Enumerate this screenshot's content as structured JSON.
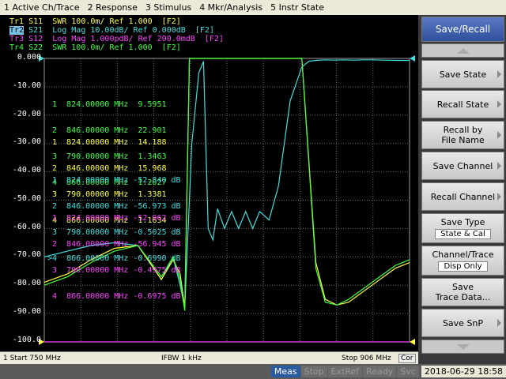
{
  "menu": [
    "1 Active Ch/Trace",
    "2 Response",
    "3 Stimulus",
    "4 Mkr/Analysis",
    "5 Instr State"
  ],
  "traces": [
    {
      "id": "Tr1",
      "text": "S11  SWR 100.0m/ Ref 1.000  [F2]",
      "color": "#ffff40"
    },
    {
      "id": "Tr2",
      "text": "S21  Log Mag 10.00dB/ Ref 0.000dB  [F2]",
      "color": "#40e0e0"
    },
    {
      "id": "Tr3",
      "text": "S12  Log Mag 1.000pdB/ Ref 200.0mdB  [F2]",
      "color": "#ff40ff"
    },
    {
      "id": "Tr4",
      "text": "S22  SWR 100.0m/ Ref 1.000  [F2]",
      "color": "#40ff40"
    }
  ],
  "y_labels": [
    "0.000",
    "-10.00",
    "-20.00",
    "-30.00",
    "-40.00",
    "-50.00",
    "-60.00",
    "-70.00",
    "-80.00",
    "-90.00",
    "-100.0"
  ],
  "marker_tables": [
    {
      "color": "#40ff40",
      "rows": [
        "1  824.00000 MHz  9.5951",
        "2  846.00000 MHz  22.901",
        "3  790.00000 MHz  1.3463",
        "4  866.00000 MHz  1.2027"
      ]
    },
    {
      "color": "#ffff40",
      "rows": [
        "1  824.00000 MHz  14.188",
        "2  846.00000 MHz  15.968",
        "3  790.00000 MHz  1.3381",
        "4  866.00000 MHz  1.1634"
      ]
    },
    {
      "color": "#40e0e0",
      "rows": [
        "1  824.00000 MHz -52.840 dB",
        "2  846.00000 MHz -56.973 dB",
        "3  790.00000 MHz -0.5025 dB",
        ">4  866.00000 MHz -0.6990 dB"
      ]
    },
    {
      "color": "#ff40ff",
      "rows": [
        "1  824.00000 MHz -52.962 dB",
        "2  846.00000 MHz -56.945 dB",
        "3  790.00000 MHz -0.4975 dB",
        "4  866.00000 MHz -0.6975 dB"
      ]
    }
  ],
  "status": {
    "start": "1  Start 750 MHz",
    "ifbw": "IFBW 1 kHz",
    "stop": "Stop 906 MHz",
    "cor": "Cor"
  },
  "bottom": {
    "meas": "Meas",
    "stop": "Stop",
    "extref": "ExtRef",
    "ready": "Ready",
    "svc": "Svc",
    "datetime": "2018-06-29 18:58"
  },
  "side": {
    "title": "Save/Recall",
    "save_state": "Save State",
    "recall_state": "Recall State",
    "recall_by_file_1": "Recall by",
    "recall_by_file_2": "File Name",
    "save_channel": "Save Channel",
    "recall_channel": "Recall Channel",
    "save_type": "Save Type",
    "save_type_value": "State & Cal",
    "channel_trace": "Channel/Trace",
    "channel_trace_value": "Disp Only",
    "save_trace_1": "Save",
    "save_trace_2": "Trace Data...",
    "save_snp": "Save SnP"
  },
  "chart_data": {
    "type": "line",
    "x_unit": "MHz",
    "xlim": [
      750,
      906
    ],
    "ylim": [
      -100,
      0
    ],
    "y_unit": "dB",
    "grid": true,
    "series": [
      {
        "name": "Tr2 S21",
        "color": "#40e0e0",
        "x": [
          750,
          760,
          770,
          780,
          790,
          800,
          805,
          808,
          810,
          813,
          816,
          818,
          820,
          822,
          824,
          827,
          830,
          833,
          836,
          839,
          842,
          846,
          850,
          855,
          860,
          863,
          866,
          870,
          874,
          878,
          882,
          886,
          890,
          895,
          900,
          906
        ],
        "y": [
          -70,
          -68,
          -66,
          -65,
          -66,
          -78,
          -70,
          -80,
          -88,
          -30,
          -5,
          -1,
          -60,
          -64,
          -53,
          -60,
          -54,
          -60,
          -54,
          -60,
          -54,
          -57,
          -45,
          -15,
          -3,
          -1,
          -0.7,
          -0.5,
          -0.6,
          -0.5,
          -0.6,
          -0.5,
          -0.5,
          -0.6,
          -0.7,
          -0.7
        ]
      },
      {
        "name": "Tr3 S12",
        "color": "#ff40ff",
        "x": [
          750,
          906
        ],
        "y": [
          -100,
          -100
        ]
      },
      {
        "name": "Tr1 S11",
        "color": "#ffff40",
        "x": [
          750,
          760,
          770,
          780,
          790,
          800,
          805,
          808,
          810,
          812,
          850,
          860,
          866,
          870,
          875,
          880,
          890,
          900,
          906
        ],
        "y": [
          -79,
          -76,
          -71,
          -67,
          -66,
          -78,
          -71,
          -76,
          -88,
          0,
          0,
          0,
          -72,
          -85,
          -87,
          -86,
          -80,
          -74,
          -72
        ]
      },
      {
        "name": "Tr4 S22",
        "color": "#40ff40",
        "x": [
          750,
          760,
          770,
          780,
          790,
          800,
          805,
          808,
          810,
          812,
          850,
          860,
          866,
          870,
          875,
          880,
          890,
          900,
          906
        ],
        "y": [
          -80,
          -77,
          -72,
          -68,
          -66,
          -77,
          -70,
          -78,
          -89,
          0,
          0,
          0,
          -74,
          -86,
          -87,
          -85,
          -79,
          -73,
          -71
        ]
      }
    ]
  }
}
